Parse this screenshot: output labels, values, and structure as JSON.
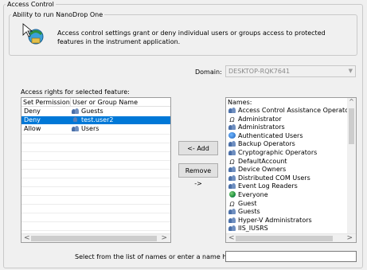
{
  "access_control_title": "Access Control",
  "ability_title": "Ability to run NanoDrop One",
  "description": "Access control settings grant or deny individual users or groups access to protected features in the instrument application.",
  "domain": {
    "label": "Domain:",
    "value": "DESKTOP-RQK7641"
  },
  "rights_label": "Access rights for selected feature:",
  "rights_table": {
    "columns": [
      "Set Permission",
      "User or Group Name"
    ],
    "rows": [
      {
        "permission": "Deny",
        "name": "Guests",
        "icon": "group-icon",
        "selected": false
      },
      {
        "permission": "Deny",
        "name": "test.user2",
        "icon": "user-icon",
        "selected": true
      },
      {
        "permission": "Allow",
        "name": "Users",
        "icon": "group-icon",
        "selected": false
      }
    ]
  },
  "buttons": {
    "add": "<- Add",
    "remove": "Remove ->"
  },
  "names_list": {
    "header": "Names:",
    "items": [
      {
        "name": "Access Control Assistance Operators",
        "icon": "group-icon"
      },
      {
        "name": "Administrator",
        "icon": "single-user-icon"
      },
      {
        "name": "Administrators",
        "icon": "group-icon"
      },
      {
        "name": "Authenticated Users",
        "icon": "authenticated-users-icon"
      },
      {
        "name": "Backup Operators",
        "icon": "group-icon"
      },
      {
        "name": "Cryptographic Operators",
        "icon": "group-icon"
      },
      {
        "name": "DefaultAccount",
        "icon": "single-user-icon"
      },
      {
        "name": "Device Owners",
        "icon": "group-icon"
      },
      {
        "name": "Distributed COM Users",
        "icon": "group-icon"
      },
      {
        "name": "Event Log Readers",
        "icon": "group-icon"
      },
      {
        "name": "Everyone",
        "icon": "globe-icon"
      },
      {
        "name": "Guest",
        "icon": "single-user-icon"
      },
      {
        "name": "Guests",
        "icon": "group-icon"
      },
      {
        "name": "Hyper-V Administrators",
        "icon": "group-icon"
      },
      {
        "name": "IIS_IUSRS",
        "icon": "group-icon"
      }
    ]
  },
  "bottom_label": "Select from the list of names or enter a name here:",
  "name_input_value": "",
  "colors": {
    "selection": "#0078d7",
    "background": "#f0f0f0"
  }
}
